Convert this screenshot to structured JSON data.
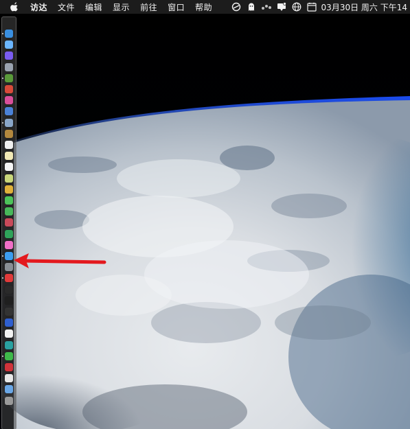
{
  "menubar": {
    "apple_icon": "apple-icon",
    "app_name": "访达",
    "items": [
      "文件",
      "编辑",
      "显示",
      "前往",
      "窗口",
      "帮助"
    ],
    "status_icons": [
      "sync-icon",
      "qq-ghost-icon",
      "dots-icon",
      "notification-icon",
      "globe-icon",
      "calendar-icon"
    ],
    "clock": "03月30日 周六 下午14"
  },
  "dock": {
    "items": [
      {
        "name": "finder-icon",
        "color": "#3a8fe0"
      },
      {
        "name": "safari-icon",
        "color": "#6bb6ff"
      },
      {
        "name": "siri-icon",
        "color": "#7a5cf0"
      },
      {
        "name": "launchpad-icon",
        "color": "#9aa3b0"
      },
      {
        "name": "android-studio-icon",
        "color": "#5a9a3a"
      },
      {
        "name": "app-red-icon",
        "color": "#d84a3a"
      },
      {
        "name": "app-pink-icon",
        "color": "#d94f9b"
      },
      {
        "name": "xcode-icon",
        "color": "#4b82d8"
      },
      {
        "name": "preview-icon",
        "color": "#8aa7c9"
      },
      {
        "name": "notebook-icon",
        "color": "#b3883e"
      },
      {
        "name": "calendar-app-icon",
        "color": "#f0f0f0"
      },
      {
        "name": "notes-icon",
        "color": "#f2e9b6"
      },
      {
        "name": "reminders-icon",
        "color": "#f6f6f6"
      },
      {
        "name": "photos-icon",
        "color": "#c9d67a"
      },
      {
        "name": "chrome-icon",
        "color": "#e0b13a"
      },
      {
        "name": "messages-icon",
        "color": "#4dc45a"
      },
      {
        "name": "facetime-icon",
        "color": "#48b85a"
      },
      {
        "name": "photo-booth-icon",
        "color": "#c84a5a"
      },
      {
        "name": "numbers-icon",
        "color": "#2fa35a"
      },
      {
        "name": "itunes-icon",
        "color": "#f06fc7"
      },
      {
        "name": "app-store-icon",
        "color": "#3c9df0"
      },
      {
        "name": "system-preferences-icon",
        "color": "#8a8f96"
      },
      {
        "name": "vivaldi-icon",
        "color": "#e03a3a"
      },
      {
        "name": "terminal-icon",
        "color": "#2a2a2a"
      },
      {
        "name": "activity-monitor-icon",
        "color": "#1f1f1f"
      },
      {
        "name": "console-icon",
        "color": "#333333"
      },
      {
        "name": "vpn-icon",
        "color": "#2f5fcf"
      },
      {
        "name": "yandex-icon",
        "color": "#f2f2f2"
      },
      {
        "name": "network-icon",
        "color": "#2aa1a1"
      },
      {
        "name": "wechat-icon",
        "color": "#3fb94a"
      },
      {
        "name": "netease-music-icon",
        "color": "#d0333a"
      },
      {
        "name": "file-icon",
        "color": "#e8e8e8"
      },
      {
        "name": "folder-icon",
        "color": "#6aa7e6"
      },
      {
        "name": "trash-icon",
        "color": "#9a9a9a"
      }
    ]
  },
  "annotation": {
    "arrow_color": "#e3191e"
  },
  "wallpaper": {
    "name": "earth-from-orbit"
  }
}
